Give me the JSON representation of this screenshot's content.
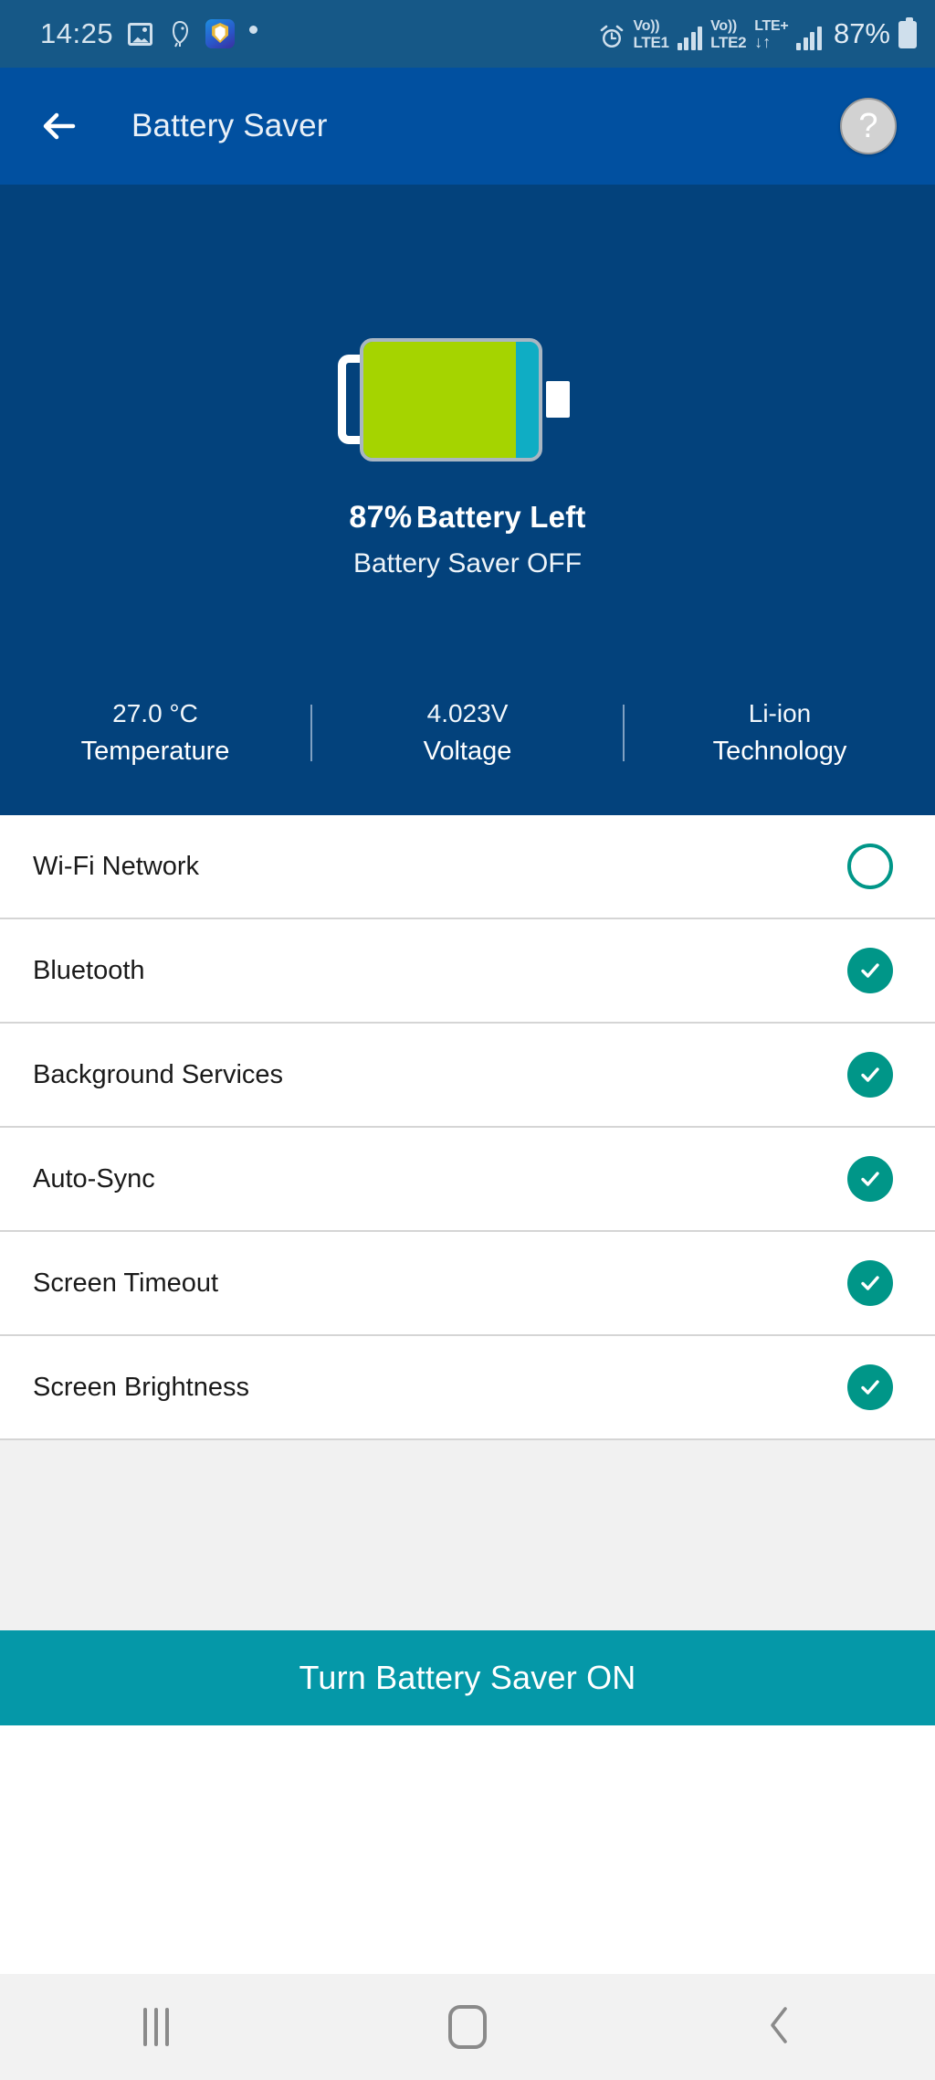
{
  "statusbar": {
    "time": "14:25",
    "icons_left": [
      "gallery-icon",
      "bird-icon",
      "shield-app-icon",
      "dot-icon"
    ],
    "alarm_icon": "alarm-icon",
    "sim1": {
      "volte": "Vo))",
      "label": "LTE1"
    },
    "sim2": {
      "volte": "Vo))",
      "label": "LTE2"
    },
    "lte_plus": {
      "label": "LTE+",
      "arrows": "↓↑"
    },
    "battery_percent": "87%"
  },
  "appbar": {
    "back_icon": "back-arrow-icon",
    "title": "Battery Saver",
    "help_label": "?"
  },
  "hero": {
    "battery_fill_percent": 87,
    "percent_text": "87%",
    "battery_left_label": "Battery Left",
    "saver_state": "Battery Saver OFF",
    "stats": [
      {
        "value": "27.0 °C",
        "caption": "Temperature"
      },
      {
        "value": "4.023V",
        "caption": "Voltage"
      },
      {
        "value": "Li-ion",
        "caption": "Technology"
      }
    ]
  },
  "list": {
    "items": [
      {
        "label": "Wi-Fi Network",
        "checked": false
      },
      {
        "label": "Bluetooth",
        "checked": true
      },
      {
        "label": "Background Services",
        "checked": true
      },
      {
        "label": "Auto-Sync",
        "checked": true
      },
      {
        "label": "Screen Timeout",
        "checked": true
      },
      {
        "label": "Screen Brightness",
        "checked": true
      }
    ]
  },
  "cta": {
    "label": "Turn Battery Saver ON"
  },
  "navbar": {
    "recents_label": "recents-icon",
    "home_label": "home-icon",
    "back_label": "back-icon"
  },
  "colors": {
    "statusbar_bg": "#165887",
    "appbar_bg": "#0150a0",
    "hero_bg": "#03427c",
    "accent_teal": "#009688",
    "cta_bg": "#0598a8",
    "battery_green": "#a5d400",
    "battery_teal": "#0fadc4"
  }
}
